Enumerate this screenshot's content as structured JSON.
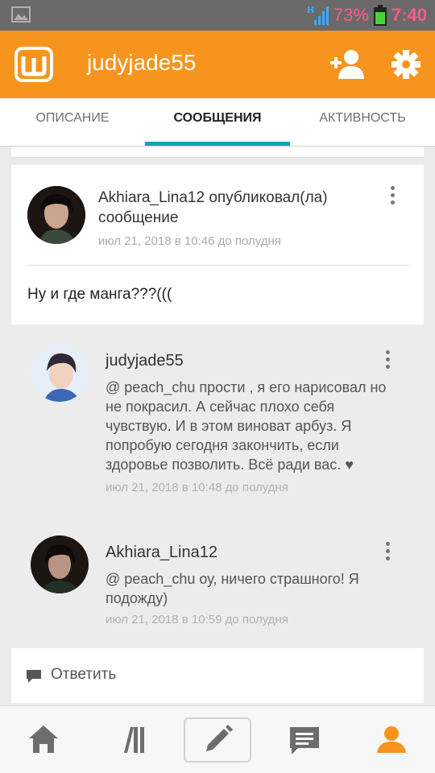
{
  "status_bar": {
    "network": "H",
    "battery_percent": "73%",
    "time": "7:40",
    "accent_color": "#ff5a8a"
  },
  "app_bar": {
    "logo_icon": "wattpad-logo-icon",
    "title": "judyjade55",
    "background": "#f7941d"
  },
  "tabs": [
    {
      "label": "ОПИСАНИЕ",
      "active": false
    },
    {
      "label": "СООБЩЕНИЯ",
      "active": true
    },
    {
      "label": "АКТИВНОСТЬ",
      "active": false
    }
  ],
  "post": {
    "author": "Akhiara_Lina12",
    "action": "опубликовал(ла) сообщение",
    "time": "июл 21, 2018 в 10:46 до полудня",
    "body": "Ну и где манга???((("
  },
  "replies": [
    {
      "author": "judyjade55",
      "text": "@ peach_chu  прости , я его нарисовал но не покрасил. А сейчас плохо себя чувствую. И в этом виноват арбуз. Я попробую сегодня закончить, если здоровье позволить. Всё ради вас.",
      "time": "июл 21, 2018 в 10:48 до полудня"
    },
    {
      "author": "Akhiara_Lina12",
      "text": "@ peach_chu  оу, ничего страшного! Я подожду)",
      "time": "июл 21, 2018 в 10:59 до полудня"
    }
  ],
  "reply_action": {
    "label": "Ответить"
  },
  "bottom_nav": [
    {
      "icon": "home-icon"
    },
    {
      "icon": "library-icon"
    },
    {
      "icon": "pencil-icon",
      "selected": true
    },
    {
      "icon": "messages-icon"
    },
    {
      "icon": "profile-icon",
      "active_color": "#f7941d"
    }
  ]
}
